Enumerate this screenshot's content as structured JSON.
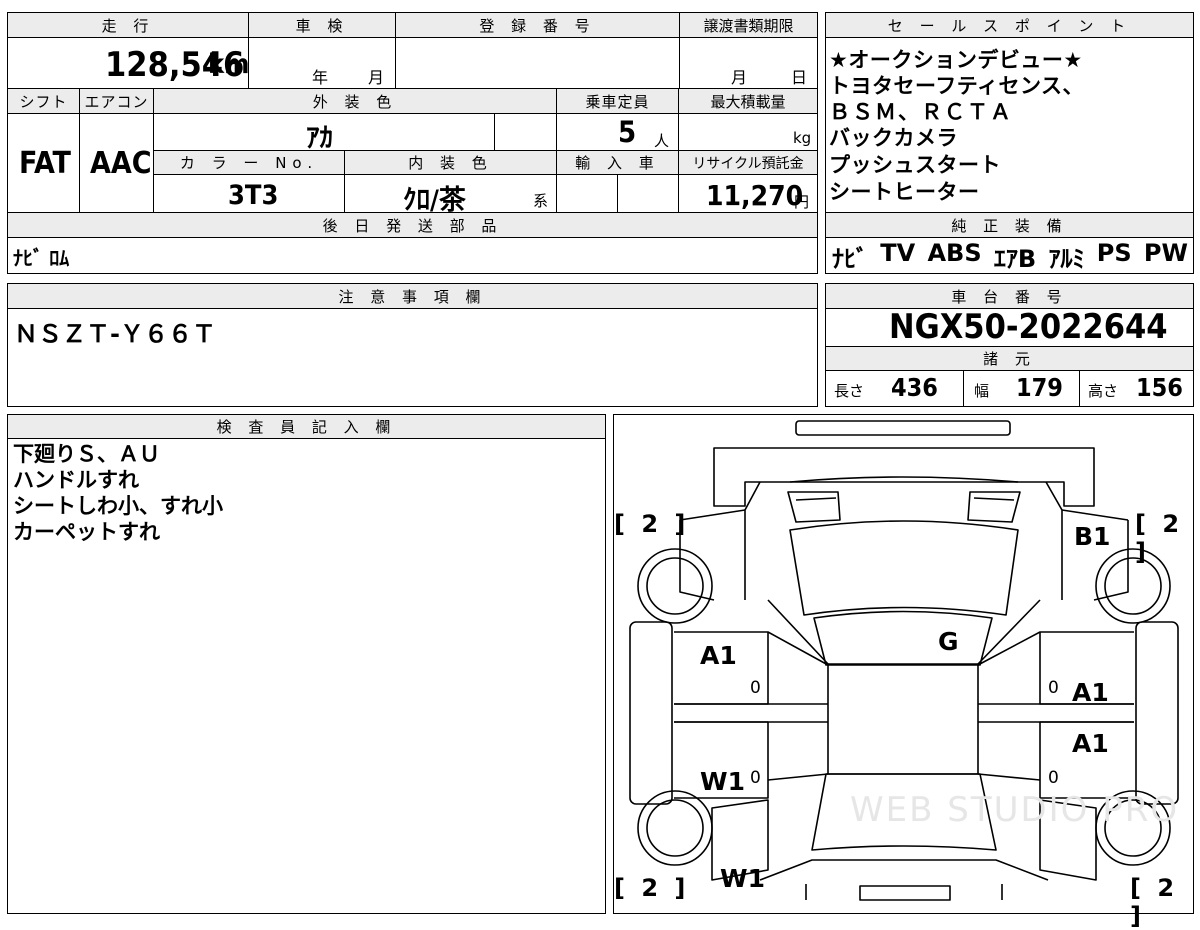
{
  "vehicle": {
    "mileage_label": "走 行",
    "mileage_value": "128,546",
    "mileage_unit": "km",
    "inspection_label": "車 検",
    "inspection_year": "年",
    "inspection_month": "月",
    "registration_label": "登 録 番 号",
    "transfer_label": "譲渡書類期限",
    "transfer_month": "月",
    "transfer_day": "日",
    "shift_label": "シフト",
    "shift_value": "FAT",
    "aircon_label": "エアコン",
    "aircon_value": "AAC",
    "exterior_label": "外 装 色",
    "exterior_value": "ｱｶ",
    "capacity_label": "乗車定員",
    "capacity_value": "5",
    "capacity_unit": "人",
    "load_label": "最大積載量",
    "load_unit": "kg",
    "color_no_label": "カ ラ ー No.",
    "color_no_value": "3T3",
    "interior_label": "内 装 色",
    "interior_value": "ｸﾛ/茶",
    "interior_suffix": "系",
    "import_label": "輸 入 車",
    "recycle_label": "リサイクル預託金",
    "recycle_value": "11,270",
    "recycle_unit": "円",
    "later_parts_label": "後 日 発 送 部 品",
    "later_parts_value": "ﾅﾋﾞ ﾛﾑ",
    "notes_label": "注 意 事 項 欄",
    "notes_value": "ＮＳＺＴ-Ｙ６６Ｔ"
  },
  "sales": {
    "label": "セ ー ル ス ポ イ ン ト",
    "lines": [
      "★オークションデビュー★",
      "トヨタセーフティセンス、",
      "ＢＳＭ、ＲＣＴＡ",
      "バックカメラ",
      "プッシュスタート",
      "シートヒーター"
    ]
  },
  "equipment": {
    "label": "純 正 装 備",
    "items": [
      "ﾅﾋﾞ",
      "TV",
      "ABS",
      "ｴｱB",
      "ｱﾙﾐ",
      "PS",
      "PW"
    ]
  },
  "chassis": {
    "label": "車 台 番 号",
    "value": "NGX50-2022644",
    "spec_label": "諸 元",
    "length_label": "長さ",
    "length_value": "436",
    "width_label": "幅",
    "width_value": "179",
    "height_label": "高さ",
    "height_value": "156"
  },
  "inspector": {
    "label": "検 査 員 記 入 欄",
    "lines": [
      "下廻りＳ、ＡＵ",
      "ハンドルすれ",
      "シートしわ小、すれ小",
      "カーペットすれ"
    ]
  },
  "diagram": {
    "bracket_tl": "[ 2 ]",
    "bracket_tr": "[ 2 ]",
    "bracket_bl": "[ 2 ]",
    "bracket_br": "[ 2 ]",
    "mark_b1": "B1",
    "mark_g": "G",
    "mark_a1_left": "A1",
    "mark_a1_right_1": "A1",
    "mark_a1_right_2": "A1",
    "mark_w1_left_1": "W1",
    "mark_w1_left_2": "W1",
    "zero_1": "0",
    "zero_2": "0",
    "zero_3": "0",
    "zero_4": "0",
    "watermark": "WEB STUDIO PRO"
  }
}
